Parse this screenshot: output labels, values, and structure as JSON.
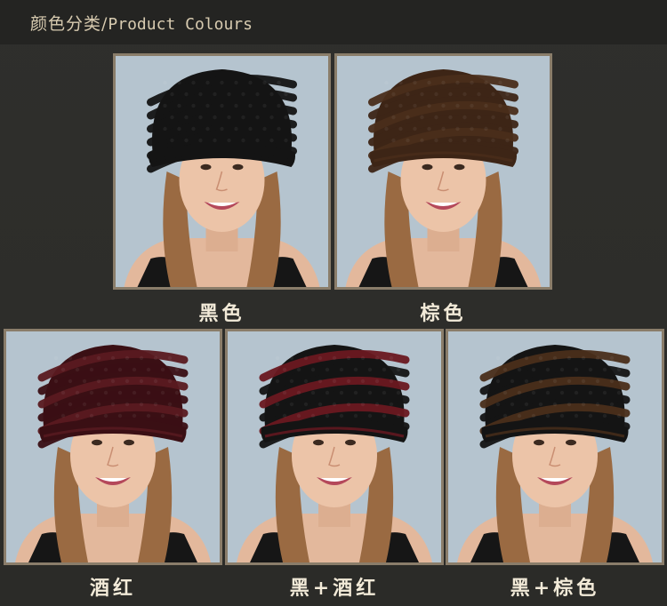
{
  "header": {
    "title_cn": "颜色分类",
    "separator": "/",
    "title_en": "Product Colours"
  },
  "products": [
    {
      "label": "黑色",
      "hat_color": "#141414",
      "stripe_color": "#141414",
      "hat_icon": "fur-hat-black"
    },
    {
      "label": "棕色",
      "hat_color": "#3d2516",
      "stripe_color": "#4a2d1a",
      "hat_icon": "fur-hat-brown"
    },
    {
      "label": "酒红",
      "hat_color": "#3a0f14",
      "stripe_color": "#5a1a20",
      "hat_icon": "fur-hat-wine-red"
    },
    {
      "label": "黑+酒红",
      "hat_color": "#141414",
      "stripe_color": "#6a1820",
      "hat_icon": "fur-hat-black-wine-red"
    },
    {
      "label": "黑+棕色",
      "hat_color": "#141414",
      "stripe_color": "#4a2e1a",
      "hat_icon": "fur-hat-black-brown"
    }
  ],
  "colors": {
    "background": "#2b2b28",
    "header_bg": "#242422",
    "header_text": "#d8cbb0",
    "caption_text": "#f2ead8",
    "frame_border": "#8a7d6a",
    "photo_bg": "#b5c4cf"
  }
}
